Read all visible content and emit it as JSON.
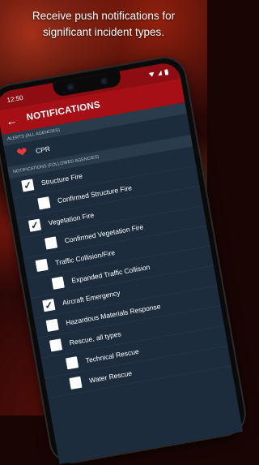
{
  "promo": {
    "line1": "Receive push notifications for",
    "line2": "significant incident types."
  },
  "status": {
    "time": "12:50"
  },
  "appbar": {
    "title": "NOTIFICATIONS"
  },
  "alerts_section": {
    "header": "ALERTS (All Agencies)",
    "items": [
      {
        "label": "CPR",
        "icon": "heart-icon"
      }
    ]
  },
  "notifications_section": {
    "header": "NOTIFICATIONS (Followed Agencies)",
    "items": [
      {
        "label": "Structure Fire",
        "checked": true
      },
      {
        "label": "Confirmed Structure Fire",
        "checked": false
      },
      {
        "label": "Vegetation Fire",
        "checked": true
      },
      {
        "label": "Confirmed Vegetation Fire",
        "checked": false
      },
      {
        "label": "Traffic Collision/Fire",
        "checked": false
      },
      {
        "label": "Expanded Traffic Collision",
        "checked": false
      },
      {
        "label": "Aircraft Emergency",
        "checked": true
      },
      {
        "label": "Hazardous Materials Response",
        "checked": false
      },
      {
        "label": "Rescue, all types",
        "checked": false
      },
      {
        "label": "Technical Rescue",
        "checked": false
      },
      {
        "label": "Water Rescue",
        "checked": false
      }
    ]
  },
  "colors": {
    "appbar": "#a50f15",
    "statusbar": "#8d0d12",
    "list_bg": "#1c2c3c",
    "heart": "#e63b3b"
  }
}
